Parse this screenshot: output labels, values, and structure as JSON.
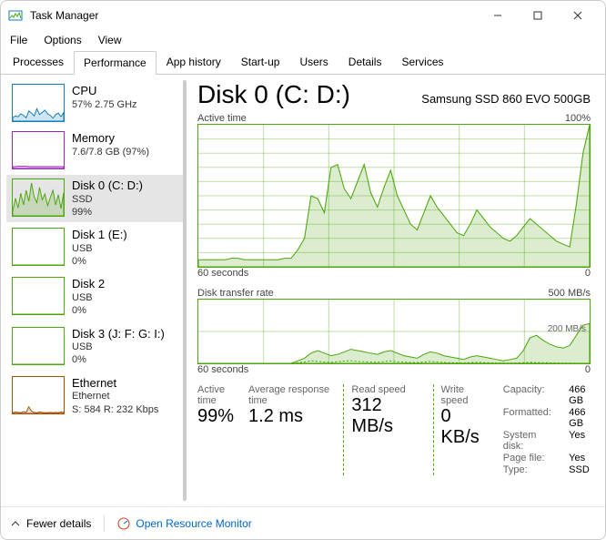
{
  "window": {
    "title": "Task Manager"
  },
  "menu": {
    "file": "File",
    "options": "Options",
    "view": "View"
  },
  "tabs": {
    "items": [
      "Processes",
      "Performance",
      "App history",
      "Start-up",
      "Users",
      "Details",
      "Services"
    ],
    "active_index": 1
  },
  "sidebar": {
    "items": [
      {
        "name": "CPU",
        "line1": "57% 2.75 GHz",
        "line2": "",
        "color": "blue",
        "spark": [
          10,
          14,
          12,
          20,
          16,
          9,
          28,
          22,
          14,
          34,
          18,
          24,
          30,
          20,
          16,
          8,
          18,
          22,
          12,
          24
        ]
      },
      {
        "name": "Memory",
        "line1": "7.6/7.8 GB (97%)",
        "line2": "",
        "color": "purple",
        "spark": [
          5,
          5,
          6,
          6,
          6,
          6,
          5,
          5,
          5,
          5,
          5,
          5,
          5,
          5,
          5,
          5,
          5,
          5,
          5,
          5
        ]
      },
      {
        "name": "Disk 0 (C: D:)",
        "line1": "SSD",
        "line2": "99%",
        "color": "green",
        "spark": [
          12,
          48,
          22,
          62,
          30,
          70,
          40,
          90,
          52,
          36,
          78,
          44,
          60,
          28,
          50,
          70,
          30,
          58,
          20,
          64
        ]
      },
      {
        "name": "Disk 1 (E:)",
        "line1": "USB",
        "line2": "0%",
        "color": "green",
        "spark": [
          0,
          0,
          0,
          0,
          0,
          0,
          0,
          0,
          0,
          0,
          0,
          0,
          0,
          0,
          0,
          0,
          0,
          0,
          0,
          0
        ]
      },
      {
        "name": "Disk 2",
        "line1": "USB",
        "line2": "0%",
        "color": "green",
        "spark": [
          0,
          0,
          0,
          0,
          0,
          0,
          0,
          0,
          0,
          0,
          0,
          0,
          0,
          0,
          0,
          0,
          0,
          0,
          0,
          0
        ]
      },
      {
        "name": "Disk 3 (J: F: G: I:)",
        "line1": "USB",
        "line2": "0%",
        "color": "green",
        "spark": [
          0,
          0,
          0,
          0,
          0,
          0,
          0,
          0,
          0,
          0,
          0,
          0,
          0,
          0,
          0,
          0,
          0,
          0,
          0,
          0
        ]
      },
      {
        "name": "Ethernet",
        "line1": "Ethernet",
        "line2": "S: 584 R: 232 Kbps",
        "color": "orange",
        "spark": [
          2,
          4,
          3,
          2,
          5,
          3,
          18,
          6,
          3,
          2,
          4,
          3,
          2,
          2,
          3,
          2,
          3,
          2,
          4,
          3
        ]
      }
    ],
    "selected_index": 2
  },
  "detail": {
    "title": "Disk 0 (C: D:)",
    "model": "Samsung SSD 860 EVO 500GB",
    "chart1": {
      "label": "Active time",
      "left": "60 seconds",
      "right_top": "100%",
      "right_bottom": "0"
    },
    "chart2": {
      "label": "Disk transfer rate",
      "left": "60 seconds",
      "right_top": "500 MB/s",
      "right_bottom": "0",
      "marker": "200 MB/s"
    },
    "stats": {
      "active_time_label": "Active time",
      "active_time": "99%",
      "art_label": "Average response time",
      "art": "1.2 ms",
      "read_label": "Read speed",
      "read": "312 MB/s",
      "write_label": "Write speed",
      "write": "0 KB/s"
    },
    "props": {
      "capacity_k": "Capacity:",
      "capacity_v": "466 GB",
      "formatted_k": "Formatted:",
      "formatted_v": "466 GB",
      "sysdisk_k": "System disk:",
      "sysdisk_v": "Yes",
      "pagefile_k": "Page file:",
      "pagefile_v": "Yes",
      "type_k": "Type:",
      "type_v": "SSD"
    }
  },
  "footer": {
    "fewer": "Fewer details",
    "orm": "Open Resource Monitor"
  },
  "chart_data": [
    {
      "type": "area",
      "title": "Active time",
      "xlabel": "60 seconds",
      "ylabel": "",
      "ylim": [
        0,
        100
      ],
      "y_unit": "%",
      "series": [
        {
          "name": "Active time",
          "values": [
            5,
            5,
            5,
            5,
            5,
            6,
            6,
            5,
            5,
            5,
            5,
            5,
            5,
            6,
            6,
            12,
            20,
            50,
            48,
            38,
            70,
            72,
            55,
            48,
            60,
            72,
            52,
            42,
            56,
            68,
            50,
            40,
            30,
            26,
            38,
            50,
            42,
            36,
            30,
            24,
            22,
            30,
            40,
            34,
            28,
            24,
            20,
            18,
            22,
            28,
            34,
            30,
            26,
            22,
            18,
            16,
            14,
            44,
            80,
            100
          ]
        }
      ]
    },
    {
      "type": "area",
      "title": "Disk transfer rate",
      "xlabel": "60 seconds",
      "ylabel": "",
      "ylim": [
        0,
        500
      ],
      "y_unit": "MB/s",
      "series": [
        {
          "name": "Read",
          "values": [
            0,
            0,
            0,
            0,
            0,
            0,
            0,
            0,
            0,
            0,
            0,
            0,
            0,
            0,
            0,
            20,
            40,
            80,
            100,
            80,
            60,
            70,
            90,
            110,
            100,
            90,
            80,
            70,
            90,
            100,
            80,
            60,
            50,
            40,
            70,
            90,
            80,
            60,
            50,
            40,
            30,
            50,
            60,
            50,
            40,
            30,
            20,
            30,
            40,
            100,
            200,
            220,
            180,
            150,
            130,
            120,
            140,
            220,
            300,
            312
          ]
        },
        {
          "name": "Write",
          "values": [
            0,
            0,
            0,
            0,
            0,
            0,
            0,
            0,
            0,
            0,
            0,
            0,
            0,
            0,
            0,
            5,
            10,
            20,
            15,
            10,
            8,
            12,
            18,
            20,
            15,
            12,
            10,
            8,
            14,
            18,
            12,
            9,
            7,
            6,
            10,
            14,
            10,
            7,
            5,
            4,
            3,
            6,
            8,
            6,
            4,
            3,
            2,
            2,
            3,
            5,
            8,
            6,
            5,
            4,
            3,
            2,
            2,
            1,
            1,
            0
          ]
        }
      ]
    }
  ]
}
